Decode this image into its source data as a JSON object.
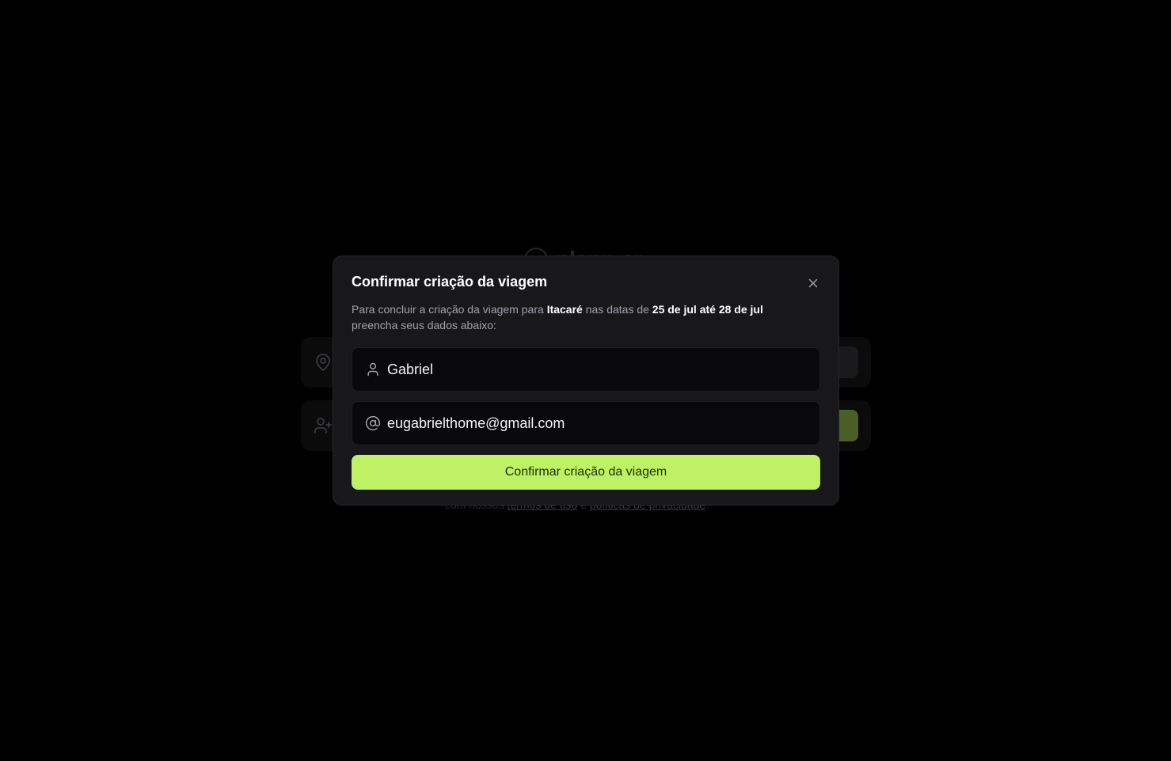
{
  "background": {
    "logo_text": "plann.er",
    "terms_prefix": "com nossos",
    "terms_link": "termos de uso",
    "terms_and": "e",
    "privacy_link": "políticas de privacidade",
    "terms_suffix": "."
  },
  "modal": {
    "title": "Confirmar criação da viagem",
    "desc_prefix": "Para concluir a criação da viagem para",
    "destination": "Itacaré",
    "desc_middle": "nas datas de",
    "dates": "25 de jul até 28 de jul",
    "desc_suffix": "preencha seus dados abaixo:",
    "name_value": "Gabriel",
    "name_icon": "user-icon",
    "email_value": "eugabrielthome@gmail.com",
    "email_icon": "at-sign-icon",
    "confirm_label": "Confirmar criação da viagem",
    "close_icon": "x-icon"
  },
  "colors": {
    "accent": "#bef264",
    "modal_bg": "#18181b",
    "field_bg": "#09090b"
  }
}
